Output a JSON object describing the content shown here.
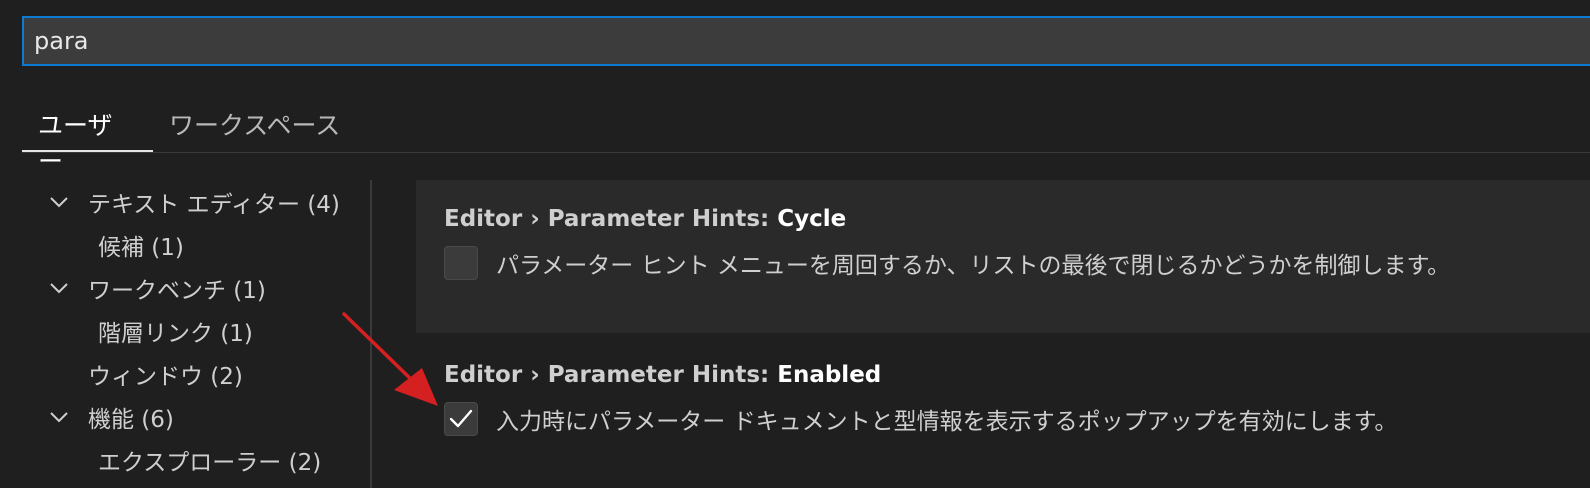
{
  "search": {
    "value": "para"
  },
  "tabs": [
    {
      "label": "ユーザー",
      "active": true
    },
    {
      "label": "ワークスペース",
      "active": false
    }
  ],
  "tree": {
    "items": [
      {
        "label": "テキスト エディター (4)",
        "level": 0,
        "expanded": true
      },
      {
        "label": "候補 (1)",
        "level": 1
      },
      {
        "label": "ワークベンチ (1)",
        "level": 0,
        "expanded": true
      },
      {
        "label": "階層リンク (1)",
        "level": 1
      },
      {
        "label": "ウィンドウ (2)",
        "level": 0,
        "expanded": false
      },
      {
        "label": "機能 (6)",
        "level": 0,
        "expanded": true
      },
      {
        "label": "エクスプローラー (2)",
        "level": 1
      }
    ]
  },
  "settings": [
    {
      "prefix": "Editor › Parameter Hints: ",
      "name": "Cycle",
      "description": "パラメーター ヒント メニューを周回するか、リストの最後で閉じるかどうかを制御します。",
      "checked": false
    },
    {
      "prefix": "Editor › Parameter Hints: ",
      "name": "Enabled",
      "description": "入力時にパラメーター ドキュメントと型情報を表示するポップアップを有効にします。",
      "checked": true
    }
  ],
  "colors": {
    "background": "#1f1f1f",
    "focus_border": "#0e7bd3",
    "annotation_arrow": "#d42020"
  }
}
